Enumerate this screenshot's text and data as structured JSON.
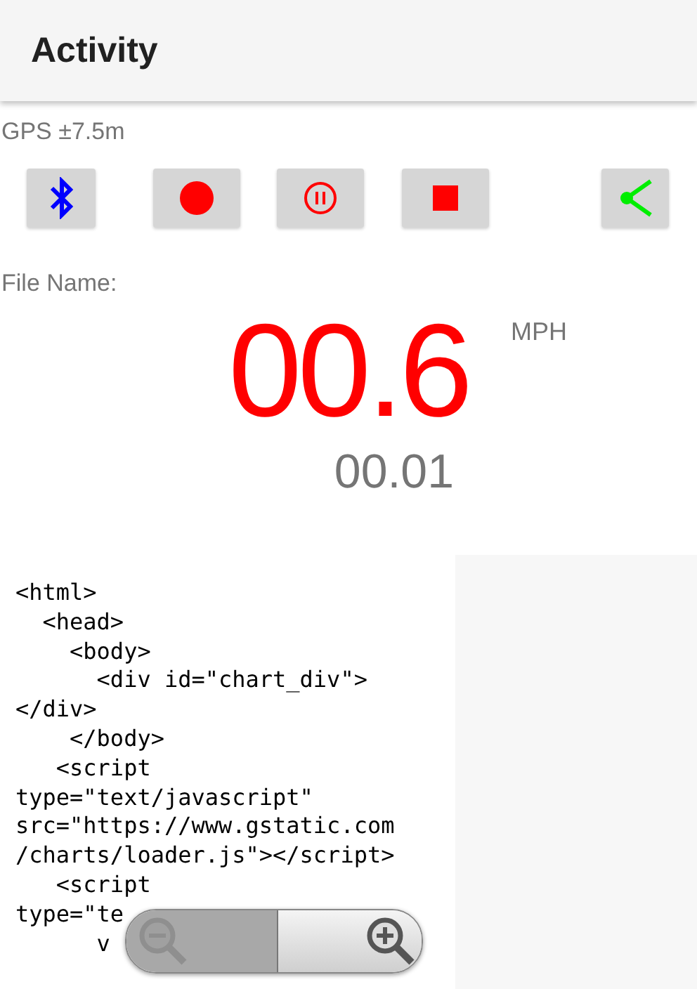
{
  "app_bar": {
    "title": "Activity"
  },
  "gps": "GPS ±7.5m",
  "buttons": [
    {
      "kind": "bluetooth"
    },
    {
      "kind": "record"
    },
    {
      "kind": "pause"
    },
    {
      "kind": "stop"
    },
    {
      "kind": "share"
    }
  ],
  "file_name_label": "File Name:",
  "speed": {
    "value": "00.6",
    "unit": "MPH",
    "distance": "00.01"
  },
  "webview": {
    "lines": [
      "<html>",
      "  <head>",
      "    <body>",
      "      <div id=\"chart_div\">",
      "</div>",
      "    </body>",
      "   <script",
      "type=\"text/javascript\"",
      "src=\"https://www.gstatic.com",
      "/charts/loader.js\"></script>",
      "   <script",
      "type=\"te",
      "      v"
    ],
    "zoom": {
      "zoom_out_disabled": true,
      "zoom_in_disabled": false
    }
  }
}
